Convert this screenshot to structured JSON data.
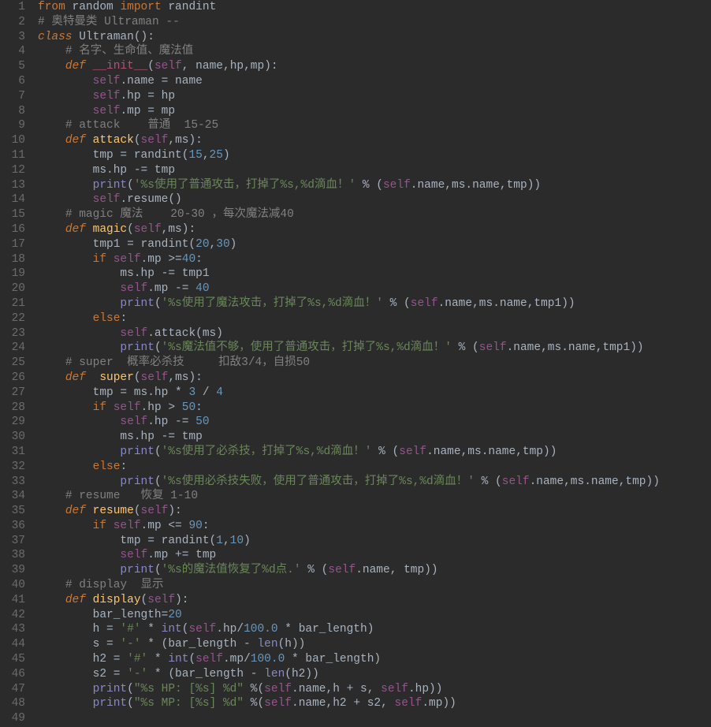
{
  "lines": [
    {
      "n": 1,
      "segs": [
        {
          "c": "kw",
          "t": "from"
        },
        {
          "c": "pn",
          "t": " random "
        },
        {
          "c": "kw",
          "t": "import"
        },
        {
          "c": "pn",
          "t": " randint"
        }
      ]
    },
    {
      "n": 2,
      "segs": [
        {
          "c": "cmt",
          "t": "# 奥特曼类 Ultraman --"
        }
      ]
    },
    {
      "n": 3,
      "segs": [
        {
          "c": "kw2",
          "t": "class "
        },
        {
          "c": "cls",
          "t": "Ultraman"
        },
        {
          "c": "pn",
          "t": "():"
        }
      ]
    },
    {
      "n": 4,
      "segs": [
        {
          "c": "pn",
          "t": "    "
        },
        {
          "c": "cmt",
          "t": "# 名字、生命值、魔法值"
        }
      ]
    },
    {
      "n": 5,
      "segs": [
        {
          "c": "pn",
          "t": "    "
        },
        {
          "c": "kw2",
          "t": "def "
        },
        {
          "c": "dfn",
          "t": "__init__"
        },
        {
          "c": "pn",
          "t": "("
        },
        {
          "c": "self",
          "t": "self"
        },
        {
          "c": "op",
          "t": ", "
        },
        {
          "c": "param",
          "t": "name"
        },
        {
          "c": "op",
          "t": ","
        },
        {
          "c": "param",
          "t": "hp"
        },
        {
          "c": "op",
          "t": ","
        },
        {
          "c": "param",
          "t": "mp"
        },
        {
          "c": "pn",
          "t": "):"
        }
      ]
    },
    {
      "n": 6,
      "segs": [
        {
          "c": "pn",
          "t": "        "
        },
        {
          "c": "self",
          "t": "self"
        },
        {
          "c": "pn",
          "t": ".name = name"
        }
      ]
    },
    {
      "n": 7,
      "segs": [
        {
          "c": "pn",
          "t": "        "
        },
        {
          "c": "self",
          "t": "self"
        },
        {
          "c": "pn",
          "t": ".hp = hp"
        }
      ]
    },
    {
      "n": 8,
      "segs": [
        {
          "c": "pn",
          "t": "        "
        },
        {
          "c": "self",
          "t": "self"
        },
        {
          "c": "pn",
          "t": ".mp = mp"
        }
      ]
    },
    {
      "n": 9,
      "segs": [
        {
          "c": "pn",
          "t": "    "
        },
        {
          "c": "cmt",
          "t": "# attack    普通  15-25"
        }
      ]
    },
    {
      "n": 10,
      "segs": [
        {
          "c": "pn",
          "t": "    "
        },
        {
          "c": "kw2",
          "t": "def "
        },
        {
          "c": "fn",
          "t": "attack"
        },
        {
          "c": "pn",
          "t": "("
        },
        {
          "c": "self",
          "t": "self"
        },
        {
          "c": "op",
          "t": ","
        },
        {
          "c": "param",
          "t": "ms"
        },
        {
          "c": "pn",
          "t": "):"
        }
      ]
    },
    {
      "n": 11,
      "segs": [
        {
          "c": "pn",
          "t": "        tmp = randint("
        },
        {
          "c": "num",
          "t": "15"
        },
        {
          "c": "op",
          "t": ","
        },
        {
          "c": "num",
          "t": "25"
        },
        {
          "c": "pn",
          "t": ")"
        }
      ]
    },
    {
      "n": 12,
      "segs": [
        {
          "c": "pn",
          "t": "        ms.hp -= tmp"
        }
      ]
    },
    {
      "n": 13,
      "segs": [
        {
          "c": "pn",
          "t": "        "
        },
        {
          "c": "builtin",
          "t": "print"
        },
        {
          "c": "pn",
          "t": "("
        },
        {
          "c": "str",
          "t": "'%s使用了普通攻击，打掉了%s,%d滴血！'"
        },
        {
          "c": "pn",
          "t": " % ("
        },
        {
          "c": "self",
          "t": "self"
        },
        {
          "c": "pn",
          "t": ".name,ms.name,tmp))"
        }
      ]
    },
    {
      "n": 14,
      "segs": [
        {
          "c": "pn",
          "t": "        "
        },
        {
          "c": "self",
          "t": "self"
        },
        {
          "c": "pn",
          "t": ".resume()"
        }
      ]
    },
    {
      "n": 15,
      "segs": [
        {
          "c": "pn",
          "t": "    "
        },
        {
          "c": "cmt",
          "t": "# magic 魔法    20-30 ，每次魔法减40"
        }
      ]
    },
    {
      "n": 16,
      "segs": [
        {
          "c": "pn",
          "t": "    "
        },
        {
          "c": "kw2",
          "t": "def "
        },
        {
          "c": "fn",
          "t": "magic"
        },
        {
          "c": "pn",
          "t": "("
        },
        {
          "c": "self",
          "t": "self"
        },
        {
          "c": "op",
          "t": ","
        },
        {
          "c": "param",
          "t": "ms"
        },
        {
          "c": "pn",
          "t": "):"
        }
      ]
    },
    {
      "n": 17,
      "segs": [
        {
          "c": "pn",
          "t": "        tmp1 = randint("
        },
        {
          "c": "num",
          "t": "20"
        },
        {
          "c": "op",
          "t": ","
        },
        {
          "c": "num",
          "t": "30"
        },
        {
          "c": "pn",
          "t": ")"
        }
      ]
    },
    {
      "n": 18,
      "segs": [
        {
          "c": "pn",
          "t": "        "
        },
        {
          "c": "kw",
          "t": "if "
        },
        {
          "c": "self",
          "t": "self"
        },
        {
          "c": "pn",
          "t": ".mp >="
        },
        {
          "c": "num",
          "t": "40"
        },
        {
          "c": "pn",
          "t": ":"
        }
      ]
    },
    {
      "n": 19,
      "segs": [
        {
          "c": "pn",
          "t": "            ms.hp -= tmp1"
        }
      ]
    },
    {
      "n": 20,
      "segs": [
        {
          "c": "pn",
          "t": "            "
        },
        {
          "c": "self",
          "t": "self"
        },
        {
          "c": "pn",
          "t": ".mp -= "
        },
        {
          "c": "num",
          "t": "40"
        }
      ]
    },
    {
      "n": 21,
      "segs": [
        {
          "c": "pn",
          "t": "            "
        },
        {
          "c": "builtin",
          "t": "print"
        },
        {
          "c": "pn",
          "t": "("
        },
        {
          "c": "str",
          "t": "'%s使用了魔法攻击，打掉了%s,%d滴血！'"
        },
        {
          "c": "pn",
          "t": " % ("
        },
        {
          "c": "self",
          "t": "self"
        },
        {
          "c": "pn",
          "t": ".name,ms.name,tmp1))"
        }
      ]
    },
    {
      "n": 22,
      "segs": [
        {
          "c": "pn",
          "t": "        "
        },
        {
          "c": "kw",
          "t": "else"
        },
        {
          "c": "pn",
          "t": ":"
        }
      ]
    },
    {
      "n": 23,
      "segs": [
        {
          "c": "pn",
          "t": "            "
        },
        {
          "c": "self",
          "t": "self"
        },
        {
          "c": "pn",
          "t": ".attack(ms)"
        }
      ]
    },
    {
      "n": 24,
      "segs": [
        {
          "c": "pn",
          "t": "            "
        },
        {
          "c": "builtin",
          "t": "print"
        },
        {
          "c": "pn",
          "t": "("
        },
        {
          "c": "str",
          "t": "'%s魔法值不够，使用了普通攻击，打掉了%s,%d滴血！'"
        },
        {
          "c": "pn",
          "t": " % ("
        },
        {
          "c": "self",
          "t": "self"
        },
        {
          "c": "pn",
          "t": ".name,ms.name,tmp1))"
        }
      ]
    },
    {
      "n": 25,
      "segs": [
        {
          "c": "pn",
          "t": "    "
        },
        {
          "c": "cmt",
          "t": "# super  概率必杀技     扣敌3/4，自损50"
        }
      ]
    },
    {
      "n": 26,
      "segs": [
        {
          "c": "pn",
          "t": "    "
        },
        {
          "c": "kw2",
          "t": "def  "
        },
        {
          "c": "fn",
          "t": "super"
        },
        {
          "c": "pn",
          "t": "("
        },
        {
          "c": "self",
          "t": "self"
        },
        {
          "c": "op",
          "t": ","
        },
        {
          "c": "param",
          "t": "ms"
        },
        {
          "c": "pn",
          "t": "):"
        }
      ]
    },
    {
      "n": 27,
      "segs": [
        {
          "c": "pn",
          "t": "        tmp = ms.hp * "
        },
        {
          "c": "num",
          "t": "3"
        },
        {
          "c": "pn",
          "t": " / "
        },
        {
          "c": "num",
          "t": "4"
        }
      ]
    },
    {
      "n": 28,
      "segs": [
        {
          "c": "pn",
          "t": "        "
        },
        {
          "c": "kw",
          "t": "if "
        },
        {
          "c": "self",
          "t": "self"
        },
        {
          "c": "pn",
          "t": ".hp > "
        },
        {
          "c": "num",
          "t": "50"
        },
        {
          "c": "pn",
          "t": ":"
        }
      ]
    },
    {
      "n": 29,
      "segs": [
        {
          "c": "pn",
          "t": "            "
        },
        {
          "c": "self",
          "t": "self"
        },
        {
          "c": "pn",
          "t": ".hp -= "
        },
        {
          "c": "num",
          "t": "50"
        }
      ]
    },
    {
      "n": 30,
      "segs": [
        {
          "c": "pn",
          "t": "            ms.hp -= tmp"
        }
      ]
    },
    {
      "n": 31,
      "segs": [
        {
          "c": "pn",
          "t": "            "
        },
        {
          "c": "builtin",
          "t": "print"
        },
        {
          "c": "pn",
          "t": "("
        },
        {
          "c": "str",
          "t": "'%s使用了必杀技，打掉了%s,%d滴血！'"
        },
        {
          "c": "pn",
          "t": " % ("
        },
        {
          "c": "self",
          "t": "self"
        },
        {
          "c": "pn",
          "t": ".name,ms.name,tmp))"
        }
      ]
    },
    {
      "n": 32,
      "segs": [
        {
          "c": "pn",
          "t": "        "
        },
        {
          "c": "kw",
          "t": "else"
        },
        {
          "c": "pn",
          "t": ":"
        }
      ]
    },
    {
      "n": 33,
      "segs": [
        {
          "c": "pn",
          "t": "            "
        },
        {
          "c": "builtin",
          "t": "print"
        },
        {
          "c": "pn",
          "t": "("
        },
        {
          "c": "str",
          "t": "'%s使用必杀技失败，使用了普通攻击，打掉了%s,%d滴血！'"
        },
        {
          "c": "pn",
          "t": " % ("
        },
        {
          "c": "self",
          "t": "self"
        },
        {
          "c": "pn",
          "t": ".name,ms.name,tmp))"
        }
      ]
    },
    {
      "n": 34,
      "segs": [
        {
          "c": "pn",
          "t": "    "
        },
        {
          "c": "cmt",
          "t": "# resume   恢复 1-10"
        }
      ]
    },
    {
      "n": 35,
      "segs": [
        {
          "c": "pn",
          "t": "    "
        },
        {
          "c": "kw2",
          "t": "def "
        },
        {
          "c": "fn",
          "t": "resume"
        },
        {
          "c": "pn",
          "t": "("
        },
        {
          "c": "self",
          "t": "self"
        },
        {
          "c": "pn",
          "t": "):"
        }
      ]
    },
    {
      "n": 36,
      "segs": [
        {
          "c": "pn",
          "t": "        "
        },
        {
          "c": "kw",
          "t": "if "
        },
        {
          "c": "self",
          "t": "self"
        },
        {
          "c": "pn",
          "t": ".mp <= "
        },
        {
          "c": "num",
          "t": "90"
        },
        {
          "c": "pn",
          "t": ":"
        }
      ]
    },
    {
      "n": 37,
      "segs": [
        {
          "c": "pn",
          "t": "            tmp = randint("
        },
        {
          "c": "num",
          "t": "1"
        },
        {
          "c": "op",
          "t": ","
        },
        {
          "c": "num",
          "t": "10"
        },
        {
          "c": "pn",
          "t": ")"
        }
      ]
    },
    {
      "n": 38,
      "segs": [
        {
          "c": "pn",
          "t": "            "
        },
        {
          "c": "self",
          "t": "self"
        },
        {
          "c": "pn",
          "t": ".mp += tmp"
        }
      ]
    },
    {
      "n": 39,
      "segs": [
        {
          "c": "pn",
          "t": "            "
        },
        {
          "c": "builtin",
          "t": "print"
        },
        {
          "c": "pn",
          "t": "("
        },
        {
          "c": "str",
          "t": "'%s的魔法值恢复了%d点.'"
        },
        {
          "c": "pn",
          "t": " % ("
        },
        {
          "c": "self",
          "t": "self"
        },
        {
          "c": "pn",
          "t": ".name, tmp))"
        }
      ]
    },
    {
      "n": 40,
      "segs": [
        {
          "c": "pn",
          "t": "    "
        },
        {
          "c": "cmt",
          "t": "# display  显示"
        }
      ]
    },
    {
      "n": 41,
      "segs": [
        {
          "c": "pn",
          "t": "    "
        },
        {
          "c": "kw2",
          "t": "def "
        },
        {
          "c": "fn",
          "t": "display"
        },
        {
          "c": "pn",
          "t": "("
        },
        {
          "c": "self",
          "t": "self"
        },
        {
          "c": "pn",
          "t": "):"
        }
      ]
    },
    {
      "n": 42,
      "segs": [
        {
          "c": "pn",
          "t": "        bar_length="
        },
        {
          "c": "num",
          "t": "20"
        }
      ]
    },
    {
      "n": 43,
      "segs": [
        {
          "c": "pn",
          "t": "        h = "
        },
        {
          "c": "str",
          "t": "'#'"
        },
        {
          "c": "pn",
          "t": " * "
        },
        {
          "c": "builtin",
          "t": "int"
        },
        {
          "c": "pn",
          "t": "("
        },
        {
          "c": "self",
          "t": "self"
        },
        {
          "c": "pn",
          "t": ".hp/"
        },
        {
          "c": "num",
          "t": "100.0"
        },
        {
          "c": "pn",
          "t": " * bar_length)"
        }
      ]
    },
    {
      "n": 44,
      "segs": [
        {
          "c": "pn",
          "t": "        s = "
        },
        {
          "c": "str",
          "t": "'-'"
        },
        {
          "c": "pn",
          "t": " * (bar_length - "
        },
        {
          "c": "builtin",
          "t": "len"
        },
        {
          "c": "pn",
          "t": "(h))"
        }
      ]
    },
    {
      "n": 45,
      "segs": [
        {
          "c": "pn",
          "t": "        h2 = "
        },
        {
          "c": "str",
          "t": "'#'"
        },
        {
          "c": "pn",
          "t": " * "
        },
        {
          "c": "builtin",
          "t": "int"
        },
        {
          "c": "pn",
          "t": "("
        },
        {
          "c": "self",
          "t": "self"
        },
        {
          "c": "pn",
          "t": ".mp/"
        },
        {
          "c": "num",
          "t": "100.0"
        },
        {
          "c": "pn",
          "t": " * bar_length)"
        }
      ]
    },
    {
      "n": 46,
      "segs": [
        {
          "c": "pn",
          "t": "        s2 = "
        },
        {
          "c": "str",
          "t": "'-'"
        },
        {
          "c": "pn",
          "t": " * (bar_length - "
        },
        {
          "c": "builtin",
          "t": "len"
        },
        {
          "c": "pn",
          "t": "(h2))"
        }
      ]
    },
    {
      "n": 47,
      "segs": [
        {
          "c": "pn",
          "t": "        "
        },
        {
          "c": "builtin",
          "t": "print"
        },
        {
          "c": "pn",
          "t": "("
        },
        {
          "c": "str",
          "t": "\"%s HP: [%s] %d\""
        },
        {
          "c": "pn",
          "t": " %("
        },
        {
          "c": "self",
          "t": "self"
        },
        {
          "c": "pn",
          "t": ".name,h + s, "
        },
        {
          "c": "self",
          "t": "self"
        },
        {
          "c": "pn",
          "t": ".hp))"
        }
      ]
    },
    {
      "n": 48,
      "segs": [
        {
          "c": "pn",
          "t": "        "
        },
        {
          "c": "builtin",
          "t": "print"
        },
        {
          "c": "pn",
          "t": "("
        },
        {
          "c": "str",
          "t": "\"%s MP: [%s] %d\""
        },
        {
          "c": "pn",
          "t": " %("
        },
        {
          "c": "self",
          "t": "self"
        },
        {
          "c": "pn",
          "t": ".name,h2 + s2, "
        },
        {
          "c": "self",
          "t": "self"
        },
        {
          "c": "pn",
          "t": ".mp))"
        }
      ]
    },
    {
      "n": 49,
      "segs": [
        {
          "c": "pn",
          "t": ""
        }
      ]
    }
  ]
}
